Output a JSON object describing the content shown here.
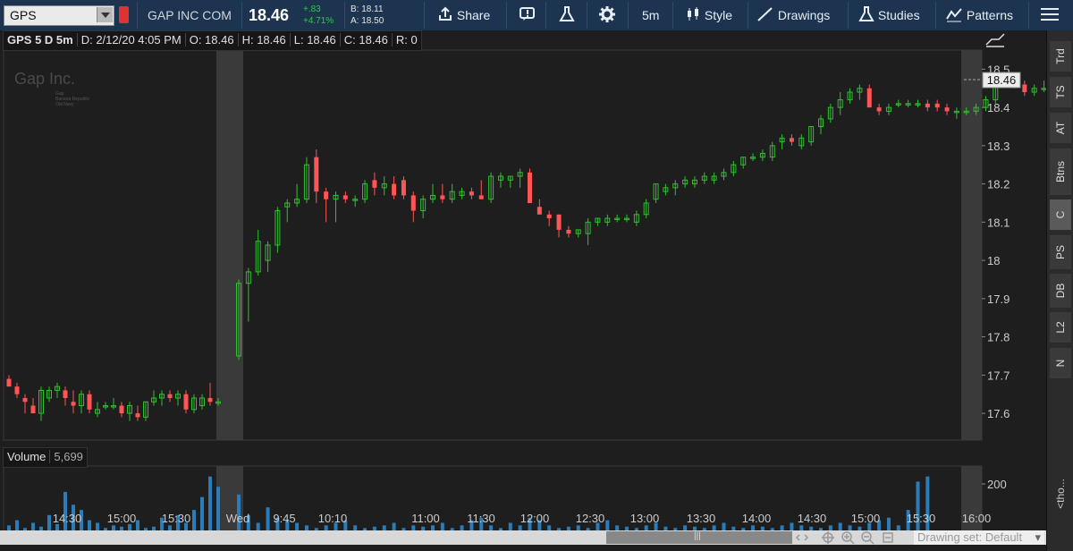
{
  "toolbar": {
    "symbol": "GPS",
    "company": "GAP INC COM",
    "last": "18.46",
    "change": "+.83",
    "change_pct": "+4.71%",
    "bid": "B: 18.11",
    "ask": "A: 18.50",
    "share_label": "Share",
    "interval_label": "5m",
    "style_label": "Style",
    "drawings_label": "Drawings",
    "studies_label": "Studies",
    "patterns_label": "Patterns"
  },
  "header": {
    "title": "GPS 5 D 5m",
    "date": "D: 2/12/20 4:05 PM",
    "open": "O: 18.46",
    "high": "H: 18.46",
    "low": "L: 18.46",
    "close": "C: 18.46",
    "range": "R: 0"
  },
  "watermark": {
    "title": "Gap Inc.",
    "lines": [
      "Gap",
      "Banana Republic",
      "Old Navy"
    ]
  },
  "volume_header": {
    "label": "Volume",
    "value": "5,699"
  },
  "right_tabs": [
    "Trd",
    "TS",
    "AT",
    "Btns",
    "C",
    "PS",
    "DB",
    "L2",
    "N"
  ],
  "selected_tab": "C",
  "right_edge_text": "<tho...",
  "drawing_set": "Drawing set: Default",
  "chart_data": {
    "type": "candlestick",
    "price_axis": {
      "ticks": [
        "18.5",
        "18.4",
        "18.3",
        "18.2",
        "18.1",
        "18",
        "17.9",
        "17.8",
        "17.7",
        "17.6"
      ],
      "range": [
        17.53,
        18.55
      ],
      "last_price_label": "18.46"
    },
    "volume_axis": {
      "ticks": [
        "200"
      ]
    },
    "time_axis": {
      "ticks": [
        "14:30",
        "15:00",
        "15:30",
        "Wed",
        "9:45",
        "10:10",
        "11:00",
        "11:30",
        "12:00",
        "12:30",
        "13:00",
        "13:30",
        "14:00",
        "14:30",
        "15:00",
        "15:30",
        "16:00"
      ]
    },
    "candles": [
      [
        17.69,
        17.7,
        17.67,
        17.67
      ],
      [
        17.67,
        17.68,
        17.64,
        17.65
      ],
      [
        17.64,
        17.65,
        17.6,
        17.63
      ],
      [
        17.62,
        17.64,
        17.6,
        17.6
      ],
      [
        17.6,
        17.67,
        17.58,
        17.66
      ],
      [
        17.64,
        17.67,
        17.63,
        17.66
      ],
      [
        17.66,
        17.68,
        17.64,
        17.67
      ],
      [
        17.66,
        17.67,
        17.62,
        17.64
      ],
      [
        17.63,
        17.66,
        17.6,
        17.62
      ],
      [
        17.62,
        17.66,
        17.6,
        17.65
      ],
      [
        17.65,
        17.66,
        17.6,
        17.61
      ],
      [
        17.6,
        17.63,
        17.59,
        17.61
      ],
      [
        17.62,
        17.63,
        17.61,
        17.62
      ],
      [
        17.62,
        17.64,
        17.61,
        17.62
      ],
      [
        17.62,
        17.63,
        17.59,
        17.6
      ],
      [
        17.6,
        17.63,
        17.58,
        17.62
      ],
      [
        17.6,
        17.62,
        17.58,
        17.59
      ],
      [
        17.59,
        17.63,
        17.58,
        17.63
      ],
      [
        17.63,
        17.66,
        17.62,
        17.64
      ],
      [
        17.64,
        17.66,
        17.62,
        17.65
      ],
      [
        17.65,
        17.66,
        17.63,
        17.64
      ],
      [
        17.64,
        17.66,
        17.62,
        17.65
      ],
      [
        17.65,
        17.66,
        17.6,
        17.61
      ],
      [
        17.61,
        17.65,
        17.6,
        17.64
      ],
      [
        17.62,
        17.65,
        17.61,
        17.64
      ],
      [
        17.64,
        17.68,
        17.62,
        17.63
      ],
      [
        17.63,
        17.64,
        17.62,
        17.63
      ],
      [
        17.75,
        17.95,
        17.74,
        17.94
      ],
      [
        17.94,
        17.98,
        17.84,
        17.97
      ],
      [
        17.97,
        18.08,
        17.96,
        18.05
      ],
      [
        18.0,
        18.05,
        17.97,
        18.04
      ],
      [
        18.04,
        18.14,
        18.02,
        18.13
      ],
      [
        18.14,
        18.16,
        18.1,
        18.15
      ],
      [
        18.15,
        18.2,
        18.14,
        18.16
      ],
      [
        18.16,
        18.27,
        18.15,
        18.25
      ],
      [
        18.27,
        18.29,
        18.15,
        18.18
      ],
      [
        18.18,
        18.19,
        18.1,
        18.16
      ],
      [
        18.16,
        18.18,
        18.1,
        18.17
      ],
      [
        18.17,
        18.18,
        18.15,
        18.16
      ],
      [
        18.16,
        18.17,
        18.14,
        18.16
      ],
      [
        18.16,
        18.21,
        18.15,
        18.2
      ],
      [
        18.21,
        18.23,
        18.17,
        18.19
      ],
      [
        18.19,
        18.22,
        18.17,
        18.2
      ],
      [
        18.2,
        18.22,
        18.16,
        18.17
      ],
      [
        18.21,
        18.22,
        18.16,
        18.17
      ],
      [
        18.17,
        18.18,
        18.1,
        18.13
      ],
      [
        18.13,
        18.17,
        18.11,
        18.16
      ],
      [
        18.16,
        18.2,
        18.15,
        18.17
      ],
      [
        18.17,
        18.2,
        18.15,
        18.16
      ],
      [
        18.16,
        18.2,
        18.15,
        18.18
      ],
      [
        18.17,
        18.19,
        18.16,
        18.18
      ],
      [
        18.18,
        18.19,
        18.16,
        18.17
      ],
      [
        18.17,
        18.21,
        18.16,
        18.16
      ],
      [
        18.16,
        18.23,
        18.15,
        18.22
      ],
      [
        18.21,
        18.23,
        18.19,
        18.22
      ],
      [
        18.21,
        18.22,
        18.19,
        18.22
      ],
      [
        18.22,
        18.24,
        18.19,
        18.23
      ],
      [
        18.23,
        18.24,
        18.15,
        18.15
      ],
      [
        18.14,
        18.16,
        18.12,
        18.12
      ],
      [
        18.12,
        18.13,
        18.09,
        18.11
      ],
      [
        18.12,
        18.12,
        18.06,
        18.08
      ],
      [
        18.08,
        18.09,
        18.06,
        18.07
      ],
      [
        18.07,
        18.08,
        18.06,
        18.08
      ],
      [
        18.07,
        18.11,
        18.04,
        18.1
      ],
      [
        18.1,
        18.11,
        18.09,
        18.11
      ],
      [
        18.1,
        18.12,
        18.09,
        18.11
      ],
      [
        18.11,
        18.12,
        18.1,
        18.11
      ],
      [
        18.11,
        18.12,
        18.1,
        18.11
      ],
      [
        18.1,
        18.13,
        18.09,
        18.12
      ],
      [
        18.12,
        18.16,
        18.11,
        18.15
      ],
      [
        18.16,
        18.2,
        18.15,
        18.2
      ],
      [
        18.18,
        18.2,
        18.17,
        18.19
      ],
      [
        18.19,
        18.21,
        18.17,
        18.2
      ],
      [
        18.2,
        18.22,
        18.19,
        18.21
      ],
      [
        18.2,
        18.22,
        18.19,
        18.21
      ],
      [
        18.21,
        18.23,
        18.2,
        18.22
      ],
      [
        18.21,
        18.23,
        18.2,
        18.22
      ],
      [
        18.22,
        18.24,
        18.21,
        18.23
      ],
      [
        18.23,
        18.26,
        18.22,
        18.25
      ],
      [
        18.25,
        18.27,
        18.24,
        18.27
      ],
      [
        18.27,
        18.28,
        18.26,
        18.27
      ],
      [
        18.27,
        18.29,
        18.26,
        18.28
      ],
      [
        18.27,
        18.31,
        18.26,
        18.3
      ],
      [
        18.31,
        18.33,
        18.29,
        18.32
      ],
      [
        18.32,
        18.33,
        18.3,
        18.31
      ],
      [
        18.3,
        18.33,
        18.29,
        18.32
      ],
      [
        18.31,
        18.35,
        18.3,
        18.35
      ],
      [
        18.35,
        18.38,
        18.33,
        18.37
      ],
      [
        18.37,
        18.41,
        18.36,
        18.4
      ],
      [
        18.4,
        18.44,
        18.38,
        18.42
      ],
      [
        18.42,
        18.45,
        18.41,
        18.44
      ],
      [
        18.44,
        18.46,
        18.42,
        18.45
      ],
      [
        18.45,
        18.46,
        18.4,
        18.4
      ],
      [
        18.4,
        18.41,
        18.38,
        18.39
      ],
      [
        18.39,
        18.41,
        18.38,
        18.4
      ],
      [
        18.41,
        18.42,
        18.4,
        18.41
      ],
      [
        18.41,
        18.42,
        18.4,
        18.41
      ],
      [
        18.41,
        18.42,
        18.4,
        18.41
      ],
      [
        18.41,
        18.42,
        18.39,
        18.4
      ],
      [
        18.41,
        18.42,
        18.39,
        18.4
      ],
      [
        18.4,
        18.41,
        18.38,
        18.39
      ],
      [
        18.39,
        18.4,
        18.37,
        18.39
      ],
      [
        18.39,
        18.4,
        18.38,
        18.39
      ],
      [
        18.39,
        18.41,
        18.38,
        18.4
      ],
      [
        18.4,
        18.43,
        18.39,
        18.42
      ],
      [
        18.42,
        18.48,
        18.41,
        18.48
      ],
      [
        18.48,
        18.49,
        18.46,
        18.47
      ],
      [
        18.47,
        18.48,
        18.45,
        18.46
      ],
      [
        18.46,
        18.47,
        18.43,
        18.44
      ],
      [
        18.44,
        18.46,
        18.43,
        18.45
      ],
      [
        18.45,
        18.47,
        18.44,
        18.45
      ],
      [
        18.45,
        18.5,
        18.44,
        18.47
      ],
      [
        18.47,
        18.48,
        18.43,
        18.45
      ],
      [
        18.45,
        18.45,
        18.45,
        18.45
      ]
    ],
    "volume": [
      6,
      10,
      4,
      8,
      5,
      14,
      7,
      32,
      22,
      18,
      10,
      8,
      4,
      6,
      5,
      7,
      10,
      4,
      5,
      12,
      6,
      14,
      8,
      18,
      28,
      44,
      36,
      30,
      14,
      8,
      20,
      12,
      10,
      8,
      6,
      4,
      6,
      8,
      10,
      6,
      4,
      5,
      6,
      8,
      4,
      6,
      5,
      6,
      8,
      4,
      6,
      10,
      12,
      6,
      4,
      8,
      6,
      12,
      10,
      6,
      4,
      5,
      6,
      4,
      8,
      10,
      6,
      5,
      4,
      6,
      8,
      5,
      4,
      6,
      5,
      4,
      6,
      8,
      5,
      4,
      6,
      5,
      4,
      6,
      8,
      6,
      5,
      4,
      6,
      8,
      6,
      5,
      8,
      10,
      12,
      6,
      18,
      40,
      44
    ]
  },
  "colors": {
    "up": "#30c030",
    "down": "#ff5555",
    "volume": "#2a7db8",
    "toolbar_bg": "#1d3450",
    "chart_bg": "#1e1e1e",
    "session_band": "#3a3a3a"
  }
}
